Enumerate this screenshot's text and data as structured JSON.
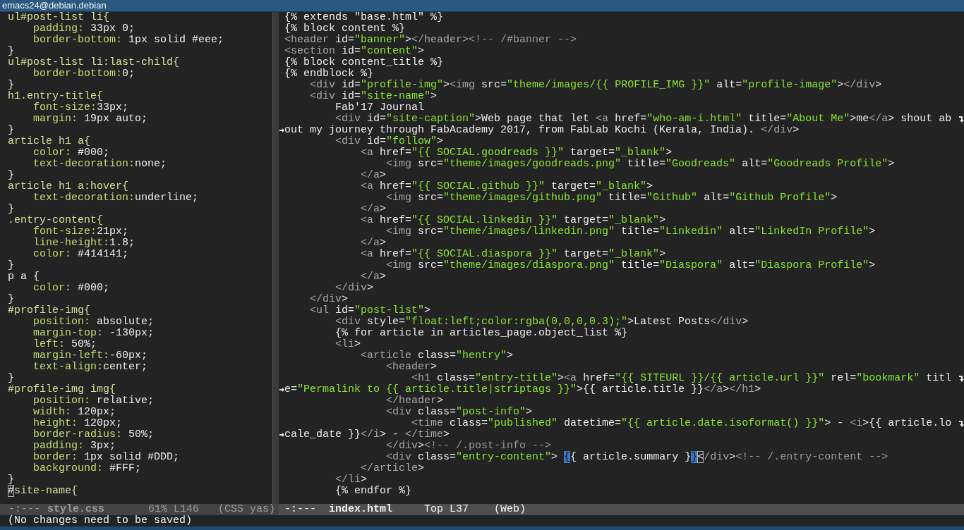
{
  "window": {
    "title": "emacs24@debian.debian"
  },
  "left_pane": {
    "lines": [
      {
        "segments": [
          {
            "kind": "selector",
            "text": "ul#post-list li{"
          }
        ]
      },
      {
        "segments": [
          {
            "kind": "property",
            "text": "    padding:"
          },
          {
            "kind": "value",
            "text": " 33px 0;"
          }
        ]
      },
      {
        "segments": [
          {
            "kind": "property",
            "text": "    border-bottom:"
          },
          {
            "kind": "value",
            "text": " 1px solid #eee;"
          }
        ]
      },
      {
        "segments": [
          {
            "kind": "value",
            "text": "}"
          }
        ]
      },
      {
        "segments": [
          {
            "kind": "selector",
            "text": "ul#post-list li:last-child{"
          }
        ]
      },
      {
        "segments": [
          {
            "kind": "property",
            "text": "    border-bottom:"
          },
          {
            "kind": "value",
            "text": "0;"
          }
        ]
      },
      {
        "segments": [
          {
            "kind": "value",
            "text": "}"
          }
        ]
      },
      {
        "segments": [
          {
            "kind": "selector",
            "text": "h1.entry-title{"
          }
        ]
      },
      {
        "segments": [
          {
            "kind": "property",
            "text": "    font-size:"
          },
          {
            "kind": "value",
            "text": "33px;"
          }
        ]
      },
      {
        "segments": [
          {
            "kind": "property",
            "text": "    margin:"
          },
          {
            "kind": "value",
            "text": " 19px auto;"
          }
        ]
      },
      {
        "segments": [
          {
            "kind": "value",
            "text": "}"
          }
        ]
      },
      {
        "segments": [
          {
            "kind": "selector",
            "text": "article h1 a{"
          }
        ]
      },
      {
        "segments": [
          {
            "kind": "property",
            "text": "    color:"
          },
          {
            "kind": "value",
            "text": " #000;"
          }
        ]
      },
      {
        "segments": [
          {
            "kind": "property",
            "text": "    text-decoration:"
          },
          {
            "kind": "value",
            "text": "none;"
          }
        ]
      },
      {
        "segments": [
          {
            "kind": "value",
            "text": "}"
          }
        ]
      },
      {
        "segments": [
          {
            "kind": "selector",
            "text": "article h1 a:hover{"
          }
        ]
      },
      {
        "segments": [
          {
            "kind": "property",
            "text": "    text-decoration:"
          },
          {
            "kind": "value",
            "text": "underline;"
          }
        ]
      },
      {
        "segments": [
          {
            "kind": "value",
            "text": "}"
          }
        ]
      },
      {
        "segments": [
          {
            "kind": "selector",
            "text": ".entry-content{"
          }
        ]
      },
      {
        "segments": [
          {
            "kind": "property",
            "text": "    font-size:"
          },
          {
            "kind": "value",
            "text": "21px;"
          }
        ]
      },
      {
        "segments": [
          {
            "kind": "property",
            "text": "    line-height:"
          },
          {
            "kind": "value",
            "text": "1.8;"
          }
        ]
      },
      {
        "segments": [
          {
            "kind": "property",
            "text": "    color:"
          },
          {
            "kind": "value",
            "text": " #414141;"
          }
        ]
      },
      {
        "segments": [
          {
            "kind": "value",
            "text": "}"
          }
        ]
      },
      {
        "segments": [
          {
            "kind": "value",
            "text": "p a {"
          }
        ]
      },
      {
        "segments": [
          {
            "kind": "property",
            "text": "    color:"
          },
          {
            "kind": "value",
            "text": " #000;"
          }
        ]
      },
      {
        "segments": [
          {
            "kind": "value",
            "text": "}"
          }
        ]
      },
      {
        "segments": [
          {
            "kind": "selector",
            "text": "#profile-img{"
          }
        ]
      },
      {
        "segments": [
          {
            "kind": "property",
            "text": "    position:"
          },
          {
            "kind": "value",
            "text": " absolute;"
          }
        ]
      },
      {
        "segments": [
          {
            "kind": "property",
            "text": "    margin-top:"
          },
          {
            "kind": "value",
            "text": " -130px;"
          }
        ]
      },
      {
        "segments": [
          {
            "kind": "property",
            "text": "    left:"
          },
          {
            "kind": "value",
            "text": " 50%;"
          }
        ]
      },
      {
        "segments": [
          {
            "kind": "property",
            "text": "    margin-left:"
          },
          {
            "kind": "value",
            "text": "-60px;"
          }
        ]
      },
      {
        "segments": [
          {
            "kind": "property",
            "text": "    text-align:"
          },
          {
            "kind": "value",
            "text": "center;"
          }
        ]
      },
      {
        "segments": [
          {
            "kind": "value",
            "text": "}"
          }
        ]
      },
      {
        "segments": [
          {
            "kind": "selector",
            "text": "#profile-img img{"
          }
        ]
      },
      {
        "segments": [
          {
            "kind": "property",
            "text": "    position:"
          },
          {
            "kind": "value",
            "text": " relative;"
          }
        ]
      },
      {
        "segments": [
          {
            "kind": "property",
            "text": "    width:"
          },
          {
            "kind": "value",
            "text": " 120px;"
          }
        ]
      },
      {
        "segments": [
          {
            "kind": "property",
            "text": "    height:"
          },
          {
            "kind": "value",
            "text": " 120px;"
          }
        ]
      },
      {
        "segments": [
          {
            "kind": "property",
            "text": "    border-radius:"
          },
          {
            "kind": "value",
            "text": " 50%;"
          }
        ]
      },
      {
        "segments": [
          {
            "kind": "property",
            "text": "    padding:"
          },
          {
            "kind": "value",
            "text": " 3px;"
          }
        ]
      },
      {
        "segments": [
          {
            "kind": "property",
            "text": "    border:"
          },
          {
            "kind": "value",
            "text": " 1px solid #DDD;"
          }
        ]
      },
      {
        "segments": [
          {
            "kind": "property",
            "text": "    background:"
          },
          {
            "kind": "value",
            "text": " #FFF;"
          }
        ]
      },
      {
        "segments": [
          {
            "kind": "value",
            "text": "}"
          }
        ]
      },
      {
        "segments": [
          {
            "kind": "cursor",
            "text": "#"
          },
          {
            "kind": "selector",
            "text": "site-name{"
          }
        ]
      }
    ],
    "mode_line": {
      "status": "-:---",
      "buffer": "style.css",
      "position": "61% L146",
      "mode": "(CSS yas)",
      "active": false
    }
  },
  "right_pane": {
    "lines": [
      {
        "segments": [
          {
            "kind": "plain",
            "text": "{% extends \"base.html\" %}"
          }
        ]
      },
      {
        "segments": [
          {
            "kind": "plain",
            "text": "{% block content %}"
          }
        ]
      },
      {
        "segments": [
          {
            "kind": "tag",
            "text": "<header"
          },
          {
            "kind": "plain",
            "text": " id="
          },
          {
            "kind": "string",
            "text": "\"banner\""
          },
          {
            "kind": "plain",
            "text": ">"
          },
          {
            "kind": "tag",
            "text": "</header>"
          },
          {
            "kind": "comment",
            "text": "<!-- /#banner -->"
          }
        ]
      },
      {
        "segments": [
          {
            "kind": "tag",
            "text": "<section"
          },
          {
            "kind": "plain",
            "text": " id="
          },
          {
            "kind": "string",
            "text": "\"content\""
          },
          {
            "kind": "plain",
            "text": ">"
          }
        ]
      },
      {
        "segments": [
          {
            "kind": "plain",
            "text": "{% block content_title %}"
          }
        ]
      },
      {
        "segments": [
          {
            "kind": "plain",
            "text": "{% endblock %}"
          }
        ]
      },
      {
        "segments": [
          {
            "kind": "tag",
            "text": "    <div"
          },
          {
            "kind": "plain",
            "text": " id="
          },
          {
            "kind": "string",
            "text": "\"profile-img\""
          },
          {
            "kind": "plain",
            "text": ">"
          },
          {
            "kind": "tag",
            "text": "<img"
          },
          {
            "kind": "plain",
            "text": " src="
          },
          {
            "kind": "string",
            "text": "\"theme/images/{{ PROFILE_IMG }}\""
          },
          {
            "kind": "plain",
            "text": " alt="
          },
          {
            "kind": "string",
            "text": "\"profile-image\""
          },
          {
            "kind": "plain",
            "text": ">"
          },
          {
            "kind": "tag",
            "text": "</div"
          },
          {
            "kind": "plain",
            "text": ">"
          }
        ]
      },
      {
        "segments": [
          {
            "kind": "tag",
            "text": "    <div"
          },
          {
            "kind": "plain",
            "text": " id="
          },
          {
            "kind": "string",
            "text": "\"site-name\""
          },
          {
            "kind": "plain",
            "text": ">"
          }
        ]
      },
      {
        "segments": [
          {
            "kind": "plain",
            "text": "        Fab'17 Journal"
          }
        ]
      },
      {
        "wraps": true,
        "segments": [
          {
            "kind": "tag",
            "text": "        <div"
          },
          {
            "kind": "plain",
            "text": " id="
          },
          {
            "kind": "string",
            "text": "\"site-caption\""
          },
          {
            "kind": "plain",
            "text": ">Web page that let "
          },
          {
            "kind": "tag",
            "text": "<a"
          },
          {
            "kind": "plain",
            "text": " href="
          },
          {
            "kind": "string",
            "text": "\"who-am-i.html\""
          },
          {
            "kind": "plain",
            "text": " title="
          },
          {
            "kind": "string",
            "text": "\"About Me\""
          },
          {
            "kind": "plain",
            "text": ">me"
          },
          {
            "kind": "tag",
            "text": "</a"
          },
          {
            "kind": "plain",
            "text": "> shout ab"
          }
        ]
      },
      {
        "continued": true,
        "segments": [
          {
            "kind": "plain",
            "text": "out my journey through FabAcademy 2017, from FabLab Kochi (Kerala, India). "
          },
          {
            "kind": "tag",
            "text": "</div"
          },
          {
            "kind": "plain",
            "text": ">"
          }
        ]
      },
      {
        "segments": [
          {
            "kind": "tag",
            "text": "        <div"
          },
          {
            "kind": "plain",
            "text": " id="
          },
          {
            "kind": "string",
            "text": "\"follow\""
          },
          {
            "kind": "plain",
            "text": ">"
          }
        ]
      },
      {
        "segments": [
          {
            "kind": "tag",
            "text": "            <a"
          },
          {
            "kind": "plain",
            "text": " href="
          },
          {
            "kind": "string",
            "text": "\"{{ SOCIAL.goodreads }}\""
          },
          {
            "kind": "plain",
            "text": " target="
          },
          {
            "kind": "string",
            "text": "\"_blank\""
          },
          {
            "kind": "plain",
            "text": ">"
          }
        ]
      },
      {
        "segments": [
          {
            "kind": "tag",
            "text": "                <img"
          },
          {
            "kind": "plain",
            "text": " src="
          },
          {
            "kind": "string",
            "text": "\"theme/images/goodreads.png\""
          },
          {
            "kind": "plain",
            "text": " title="
          },
          {
            "kind": "string",
            "text": "\"Goodreads\""
          },
          {
            "kind": "plain",
            "text": " alt="
          },
          {
            "kind": "string",
            "text": "\"Goodreads Profile\""
          },
          {
            "kind": "plain",
            "text": ">"
          }
        ]
      },
      {
        "segments": [
          {
            "kind": "tag",
            "text": "            </a"
          },
          {
            "kind": "plain",
            "text": ">"
          }
        ]
      },
      {
        "segments": [
          {
            "kind": "tag",
            "text": "            <a"
          },
          {
            "kind": "plain",
            "text": " href="
          },
          {
            "kind": "string",
            "text": "\"{{ SOCIAL.github }}\""
          },
          {
            "kind": "plain",
            "text": " target="
          },
          {
            "kind": "string",
            "text": "\"_blank\""
          },
          {
            "kind": "plain",
            "text": ">"
          }
        ]
      },
      {
        "segments": [
          {
            "kind": "tag",
            "text": "                <img"
          },
          {
            "kind": "plain",
            "text": " src="
          },
          {
            "kind": "string",
            "text": "\"theme/images/github.png\""
          },
          {
            "kind": "plain",
            "text": " title="
          },
          {
            "kind": "string",
            "text": "\"Github\""
          },
          {
            "kind": "plain",
            "text": " alt="
          },
          {
            "kind": "string",
            "text": "\"Github Profile\""
          },
          {
            "kind": "plain",
            "text": ">"
          }
        ]
      },
      {
        "segments": [
          {
            "kind": "tag",
            "text": "            </a"
          },
          {
            "kind": "plain",
            "text": ">"
          }
        ]
      },
      {
        "segments": [
          {
            "kind": "tag",
            "text": "            <a"
          },
          {
            "kind": "plain",
            "text": " href="
          },
          {
            "kind": "string",
            "text": "\"{{ SOCIAL.linkedin }}\""
          },
          {
            "kind": "plain",
            "text": " target="
          },
          {
            "kind": "string",
            "text": "\"_blank\""
          },
          {
            "kind": "plain",
            "text": ">"
          }
        ]
      },
      {
        "segments": [
          {
            "kind": "tag",
            "text": "                <img"
          },
          {
            "kind": "plain",
            "text": " src="
          },
          {
            "kind": "string",
            "text": "\"theme/images/linkedin.png\""
          },
          {
            "kind": "plain",
            "text": " title="
          },
          {
            "kind": "string",
            "text": "\"Linkedin\""
          },
          {
            "kind": "plain",
            "text": " alt="
          },
          {
            "kind": "string",
            "text": "\"LinkedIn Profile\""
          },
          {
            "kind": "plain",
            "text": ">"
          }
        ]
      },
      {
        "segments": [
          {
            "kind": "tag",
            "text": "            </a"
          },
          {
            "kind": "plain",
            "text": ">"
          }
        ]
      },
      {
        "segments": [
          {
            "kind": "tag",
            "text": "            <a"
          },
          {
            "kind": "plain",
            "text": " href="
          },
          {
            "kind": "string",
            "text": "\"{{ SOCIAL.diaspora }}\""
          },
          {
            "kind": "plain",
            "text": " target="
          },
          {
            "kind": "string",
            "text": "\"_blank\""
          },
          {
            "kind": "plain",
            "text": ">"
          }
        ]
      },
      {
        "segments": [
          {
            "kind": "tag",
            "text": "                <img"
          },
          {
            "kind": "plain",
            "text": " src="
          },
          {
            "kind": "string",
            "text": "\"theme/images/diaspora.png\""
          },
          {
            "kind": "plain",
            "text": " title="
          },
          {
            "kind": "string",
            "text": "\"Diaspora\""
          },
          {
            "kind": "plain",
            "text": " alt="
          },
          {
            "kind": "string",
            "text": "\"Diaspora Profile\""
          },
          {
            "kind": "plain",
            "text": ">"
          }
        ]
      },
      {
        "segments": [
          {
            "kind": "tag",
            "text": "            </a"
          },
          {
            "kind": "plain",
            "text": ">"
          }
        ]
      },
      {
        "segments": [
          {
            "kind": "tag",
            "text": "        </div"
          },
          {
            "kind": "plain",
            "text": ">"
          }
        ]
      },
      {
        "segments": [
          {
            "kind": "tag",
            "text": "    </div"
          },
          {
            "kind": "plain",
            "text": ">"
          }
        ]
      },
      {
        "segments": [
          {
            "kind": "tag",
            "text": "    <ul"
          },
          {
            "kind": "plain",
            "text": " id="
          },
          {
            "kind": "string",
            "text": "\"post-list\""
          },
          {
            "kind": "plain",
            "text": ">"
          }
        ]
      },
      {
        "segments": [
          {
            "kind": "tag",
            "text": "        <div"
          },
          {
            "kind": "plain",
            "text": " style="
          },
          {
            "kind": "string",
            "text": "\"float:left;color:rgba(0,0,0,0.3);\""
          },
          {
            "kind": "plain",
            "text": ">Latest Posts"
          },
          {
            "kind": "tag",
            "text": "</div"
          },
          {
            "kind": "plain",
            "text": ">"
          }
        ]
      },
      {
        "segments": [
          {
            "kind": "plain",
            "text": "        {% for article in articles_page.object_list %}"
          }
        ]
      },
      {
        "segments": [
          {
            "kind": "tag",
            "text": "        <li"
          },
          {
            "kind": "plain",
            "text": ">"
          }
        ]
      },
      {
        "segments": [
          {
            "kind": "tag",
            "text": "            <article"
          },
          {
            "kind": "plain",
            "text": " class="
          },
          {
            "kind": "string",
            "text": "\"hentry\""
          },
          {
            "kind": "plain",
            "text": ">"
          }
        ]
      },
      {
        "segments": [
          {
            "kind": "tag",
            "text": "                <header"
          },
          {
            "kind": "plain",
            "text": ">"
          }
        ]
      },
      {
        "wraps": true,
        "segments": [
          {
            "kind": "tag",
            "text": "                    <h1"
          },
          {
            "kind": "plain",
            "text": " class="
          },
          {
            "kind": "string",
            "text": "\"entry-title\""
          },
          {
            "kind": "plain",
            "text": ">"
          },
          {
            "kind": "tag",
            "text": "<a"
          },
          {
            "kind": "plain",
            "text": " href="
          },
          {
            "kind": "string",
            "text": "\"{{ SITEURL }}/{{ article.url }}\""
          },
          {
            "kind": "plain",
            "text": " rel="
          },
          {
            "kind": "string",
            "text": "\"bookmark\""
          },
          {
            "kind": "plain",
            "text": " titl"
          }
        ]
      },
      {
        "continued": true,
        "segments": [
          {
            "kind": "plain",
            "text": "e="
          },
          {
            "kind": "string",
            "text": "\"Permalink to {{ article.title|striptags }}\""
          },
          {
            "kind": "plain",
            "text": ">{{ article.title }}"
          },
          {
            "kind": "tag",
            "text": "</a"
          },
          {
            "kind": "plain",
            "text": ">"
          },
          {
            "kind": "tag",
            "text": "</h1"
          },
          {
            "kind": "plain",
            "text": ">"
          }
        ]
      },
      {
        "segments": [
          {
            "kind": "tag",
            "text": "                </header"
          },
          {
            "kind": "plain",
            "text": ">"
          }
        ]
      },
      {
        "segments": [
          {
            "kind": "tag",
            "text": "                <div"
          },
          {
            "kind": "plain",
            "text": " class="
          },
          {
            "kind": "string",
            "text": "\"post-info\""
          },
          {
            "kind": "plain",
            "text": ">"
          }
        ]
      },
      {
        "wraps": true,
        "segments": [
          {
            "kind": "tag",
            "text": "                    <time"
          },
          {
            "kind": "plain",
            "text": " class="
          },
          {
            "kind": "string",
            "text": "\"published\""
          },
          {
            "kind": "plain",
            "text": " datetime="
          },
          {
            "kind": "string",
            "text": "\"{{ article.date.isoformat() }}\""
          },
          {
            "kind": "plain",
            "text": "> - "
          },
          {
            "kind": "tag",
            "text": "<i"
          },
          {
            "kind": "plain",
            "text": ">{{ article.lo"
          }
        ]
      },
      {
        "continued": true,
        "segments": [
          {
            "kind": "plain",
            "text": "cale_date }}"
          },
          {
            "kind": "tag",
            "text": "</i"
          },
          {
            "kind": "plain",
            "text": "> - "
          },
          {
            "kind": "tag",
            "text": "</time"
          },
          {
            "kind": "plain",
            "text": ">"
          }
        ]
      },
      {
        "segments": [
          {
            "kind": "tag",
            "text": "                </div"
          },
          {
            "kind": "plain",
            "text": ">"
          },
          {
            "kind": "comment",
            "text": "<!-- /.post-info -->"
          }
        ]
      },
      {
        "segments": [
          {
            "kind": "tag",
            "text": "                <div"
          },
          {
            "kind": "plain",
            "text": " class="
          },
          {
            "kind": "string",
            "text": "\"entry-content\""
          },
          {
            "kind": "plain",
            "text": "> "
          },
          {
            "kind": "paren",
            "text": "{"
          },
          {
            "kind": "plain",
            "text": "{ article.summary }"
          },
          {
            "kind": "paren",
            "text": "}"
          },
          {
            "kind": "cursor",
            "text": "<"
          },
          {
            "kind": "tag",
            "text": "/div"
          },
          {
            "kind": "plain",
            "text": ">"
          },
          {
            "kind": "comment",
            "text": "<!-- /.entry-content -->"
          }
        ]
      },
      {
        "segments": [
          {
            "kind": "tag",
            "text": "            </article"
          },
          {
            "kind": "plain",
            "text": ">"
          }
        ]
      },
      {
        "segments": [
          {
            "kind": "tag",
            "text": "        </li"
          },
          {
            "kind": "plain",
            "text": ">"
          }
        ]
      },
      {
        "segments": [
          {
            "kind": "plain",
            "text": "        {% endfor %}"
          }
        ]
      }
    ],
    "mode_line": {
      "status": "-:---",
      "buffer": "index.html",
      "position": "Top L37",
      "mode": "(Web)",
      "active": true
    }
  },
  "echo_area": "(No changes need to be saved)"
}
